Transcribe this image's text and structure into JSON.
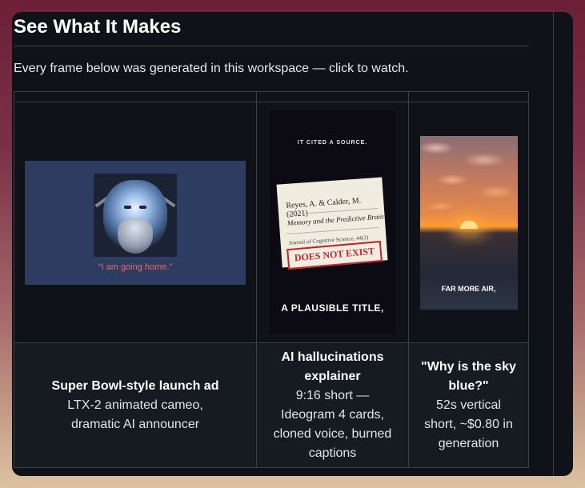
{
  "section": {
    "title": "See What It Makes",
    "intro": "Every frame below was generated in this workspace — click to watch."
  },
  "items": [
    {
      "thumb_overlay": "“I am going home.”",
      "title": "Super Bowl-style launch ad",
      "desc": "LTX-2 animated cameo, dramatic AI announcer"
    },
    {
      "thumb_top": "IT CITED A SOURCE.",
      "thumb_card_line1": "Reyes, A. & Calder, M. (2021)",
      "thumb_card_line2": "Memory and the Predictive Brain",
      "thumb_card_line3": "Journal of Cognitive Science, 44(2)",
      "thumb_stamp": "DOES NOT EXIST",
      "thumb_bottom": "A PLAUSIBLE TITLE,",
      "title": "AI hallucinations explainer",
      "desc": "9:16 short — Ideogram 4 cards, cloned voice, burned captions"
    },
    {
      "thumb_caption": "FAR MORE AIR,",
      "title": "\"Why is the sky blue?\"",
      "desc": "52s vertical short, ~$0.80 in generation"
    }
  ]
}
